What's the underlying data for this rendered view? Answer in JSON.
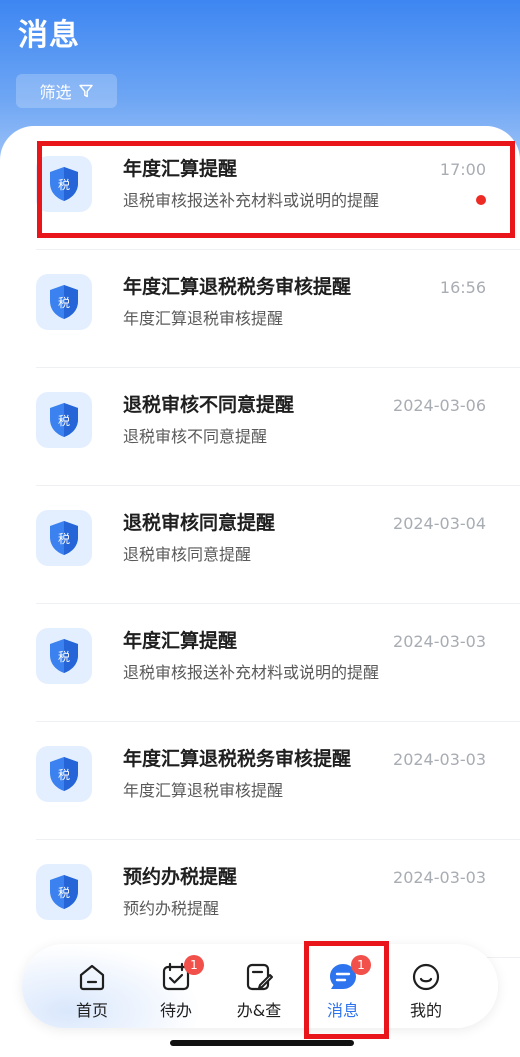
{
  "header": {
    "title": "消息",
    "filter_label": "筛选",
    "filter_icon": "filter-funnel-icon"
  },
  "messages": [
    {
      "title": "年度汇算提醒",
      "subtitle": "退税审核报送补充材料或说明的提醒",
      "time": "17:00",
      "unread": true,
      "icon": "tax-shield-icon",
      "icon_text": "税"
    },
    {
      "title": "年度汇算退税税务审核提醒",
      "subtitle": "年度汇算退税审核提醒",
      "time": "16:56",
      "unread": false,
      "icon": "tax-shield-icon",
      "icon_text": "税"
    },
    {
      "title": "退税审核不同意提醒",
      "subtitle": "退税审核不同意提醒",
      "time": "2024-03-06",
      "unread": false,
      "icon": "tax-shield-icon",
      "icon_text": "税"
    },
    {
      "title": "退税审核同意提醒",
      "subtitle": "退税审核同意提醒",
      "time": "2024-03-04",
      "unread": false,
      "icon": "tax-shield-icon",
      "icon_text": "税"
    },
    {
      "title": "年度汇算提醒",
      "subtitle": "退税审核报送补充材料或说明的提醒",
      "time": "2024-03-03",
      "unread": false,
      "icon": "tax-shield-icon",
      "icon_text": "税"
    },
    {
      "title": "年度汇算退税税务审核提醒",
      "subtitle": "年度汇算退税审核提醒",
      "time": "2024-03-03",
      "unread": false,
      "icon": "tax-shield-icon",
      "icon_text": "税"
    },
    {
      "title": "预约办税提醒",
      "subtitle": "预约办税提醒",
      "time": "2024-03-03",
      "unread": false,
      "icon": "tax-shield-icon",
      "icon_text": "税"
    }
  ],
  "tabbar": {
    "tabs": [
      {
        "label": "首页",
        "icon": "home-icon",
        "badge": null,
        "active": false
      },
      {
        "label": "待办",
        "icon": "todo-calendar-icon",
        "badge": "1",
        "active": false
      },
      {
        "label": "办&查",
        "icon": "handle-query-icon",
        "badge": null,
        "active": false
      },
      {
        "label": "消息",
        "icon": "message-bubble-icon",
        "badge": "1",
        "active": true
      },
      {
        "label": "我的",
        "icon": "profile-smile-icon",
        "badge": null,
        "active": false
      }
    ]
  },
  "colors": {
    "accent": "#2f74ef",
    "highlight": "#e8161b",
    "unread_dot": "#ee2a24",
    "badge": "#f2504a"
  }
}
